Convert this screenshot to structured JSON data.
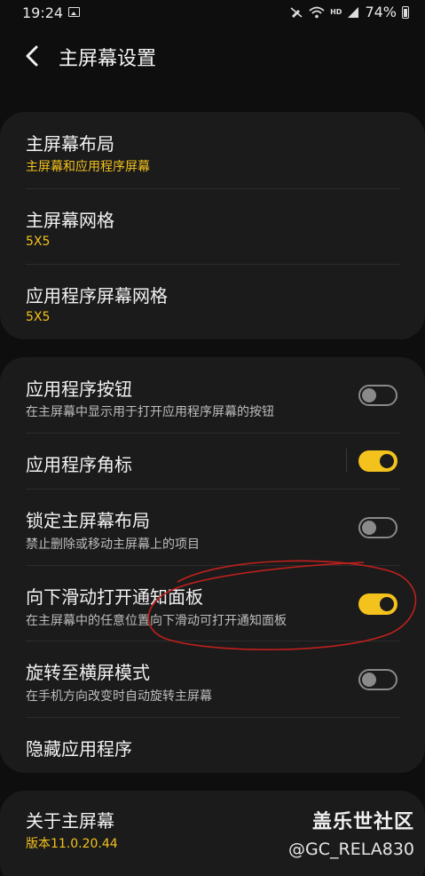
{
  "status_bar": {
    "time": "19:24",
    "battery": "74%",
    "network": "HD"
  },
  "header": {
    "title": "主屏幕设置"
  },
  "group1": [
    {
      "title": "主屏幕布局",
      "subtitle": "主屏幕和应用程序屏幕"
    },
    {
      "title": "主屏幕网格",
      "subtitle": "5X5"
    },
    {
      "title": "应用程序屏幕网格",
      "subtitle": "5X5"
    }
  ],
  "group2": [
    {
      "title": "应用程序按钮",
      "subtitle": "在主屏幕中显示用于打开应用程序屏幕的按钮",
      "toggle": false
    },
    {
      "title": "应用程序角标",
      "toggle": true
    },
    {
      "title": "锁定主屏幕布局",
      "subtitle": "禁止删除或移动主屏幕上的项目",
      "toggle": false
    },
    {
      "title": "向下滑动打开通知面板",
      "subtitle": "在主屏幕中的任意位置向下滑动可打开通知面板",
      "toggle": true
    },
    {
      "title": "旋转至横屏模式",
      "subtitle": "在手机方向改变时自动旋转主屏幕",
      "toggle": false
    },
    {
      "title": "隐藏应用程序"
    }
  ],
  "group3": [
    {
      "title": "关于主屏幕",
      "subtitle": "版本11.0.20.44"
    }
  ],
  "watermark": {
    "brand": "盖乐世社区",
    "handle": "@GC_RELA830"
  },
  "colors": {
    "accent": "#f4c21c",
    "background": "#0e0e0e",
    "card": "#1b1b1b",
    "annotation": "#c0201c"
  },
  "icons": [
    "image-icon",
    "mute-icon",
    "wifi-icon",
    "signal-icon",
    "battery-icon",
    "back-arrow-icon"
  ]
}
